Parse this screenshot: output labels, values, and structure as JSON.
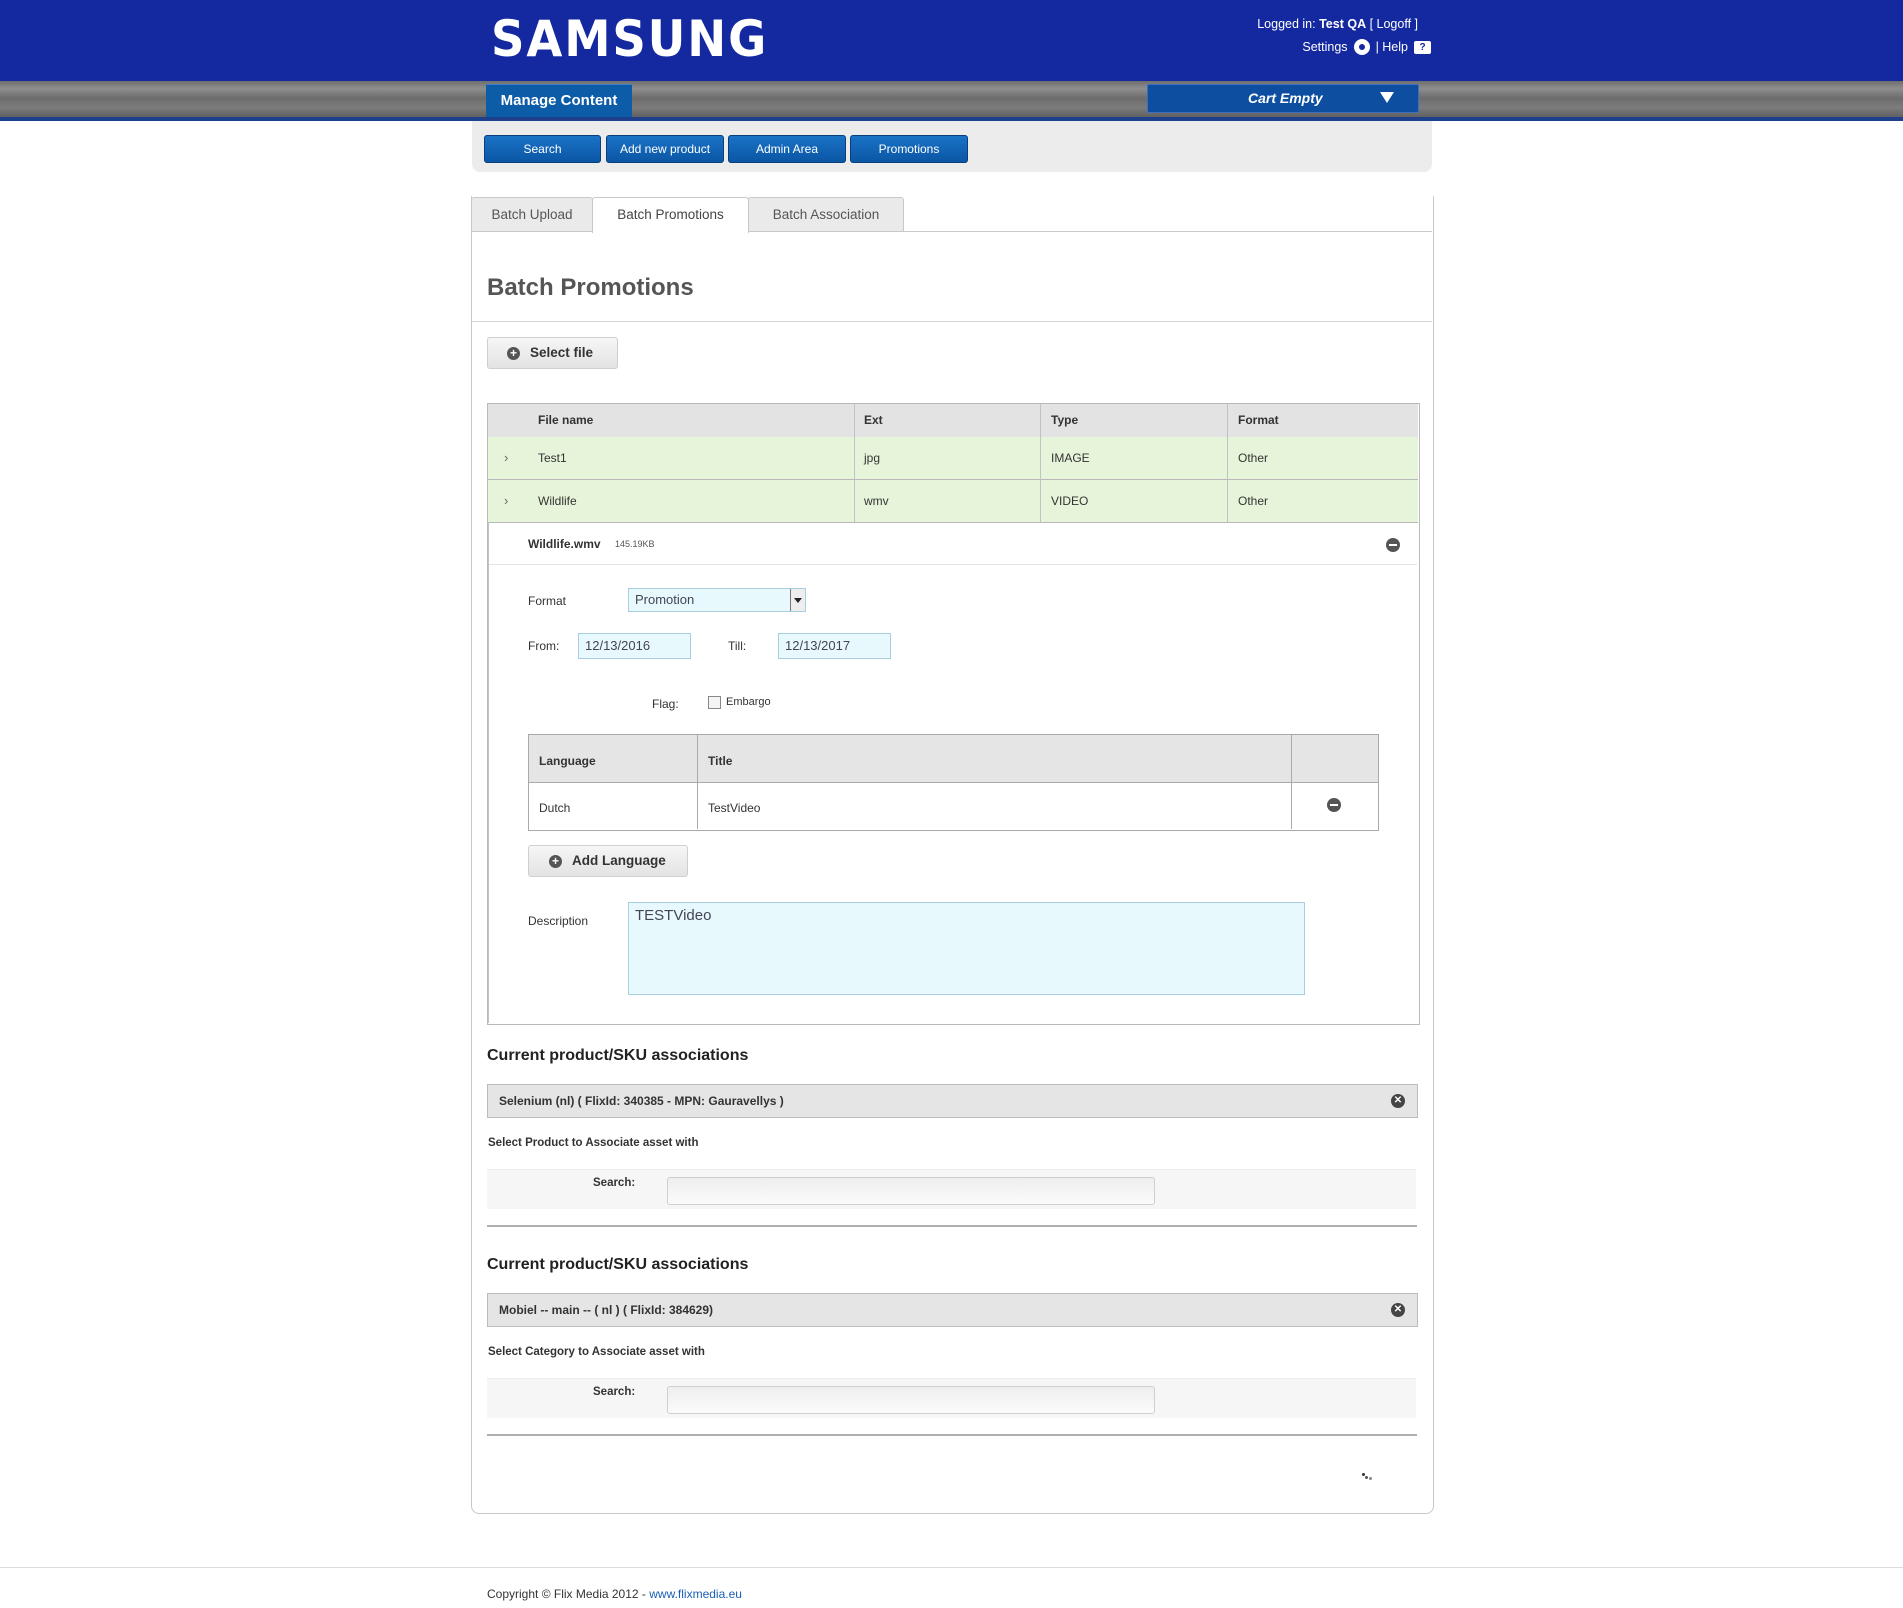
{
  "header": {
    "brand": "SAMSUNG",
    "logged_in_label": "Logged in:",
    "user": "Test QA",
    "logoff": "[ Logoff ]",
    "settings": "Settings",
    "help": "| Help",
    "help_icon_glyph": "?"
  },
  "nav": {
    "manage_content": "Manage Content",
    "cart": "Cart Empty"
  },
  "actions": [
    "Search",
    "Add new product",
    "Admin Area",
    "Promotions"
  ],
  "tabs": [
    "Batch Upload",
    "Batch Promotions",
    "Batch Association"
  ],
  "active_tab": "Batch Promotions",
  "page_title": "Batch Promotions",
  "select_file_button": "Select file",
  "file_table": {
    "columns": [
      "File name",
      "Ext",
      "Type",
      "Format"
    ],
    "rows": [
      {
        "name": "Test1",
        "ext": "jpg",
        "type": "IMAGE",
        "format": "Other"
      },
      {
        "name": "Wildlife",
        "ext": "wmv",
        "type": "VIDEO",
        "format": "Other"
      }
    ]
  },
  "detail": {
    "file_name": "Wildlife.wmv",
    "file_size": "145.19KB",
    "format_label": "Format",
    "format_value": "Promotion",
    "from_label": "From:",
    "from_value": "12/13/2016",
    "till_label": "Till:",
    "till_value": "12/13/2017",
    "flag_label": "Flag:",
    "embargo_label": "Embargo",
    "embargo_checked": false,
    "language_table": {
      "columns": [
        "Language",
        "Title"
      ],
      "rows": [
        {
          "language": "Dutch",
          "title": "TestVideo"
        }
      ]
    },
    "add_language": "Add Language",
    "description_label": "Description",
    "description_value": "TESTVideo"
  },
  "product_assoc": {
    "title": "Current product/SKU associations",
    "item": "Selenium (nl) ( FlixId: 340385 - MPN: Gauravellys )",
    "select_label": "Select Product to Associate asset with",
    "search_label": "Search:"
  },
  "category_assoc": {
    "title": "Current product/SKU associations",
    "item": "Mobiel -- main -- ( nl ) ( FlixId: 384629)",
    "select_label": "Select Category to Associate asset with",
    "search_label": "Search:"
  },
  "footer": {
    "copyright": "Copyright © Flix Media 2012 - ",
    "link": "www.flixmedia.eu"
  },
  "colors": {
    "brand_blue": "#1428a0",
    "button_blue": "#0d5ca8",
    "row_green": "#e6f5d9",
    "input_blue": "#e8f9fd"
  }
}
